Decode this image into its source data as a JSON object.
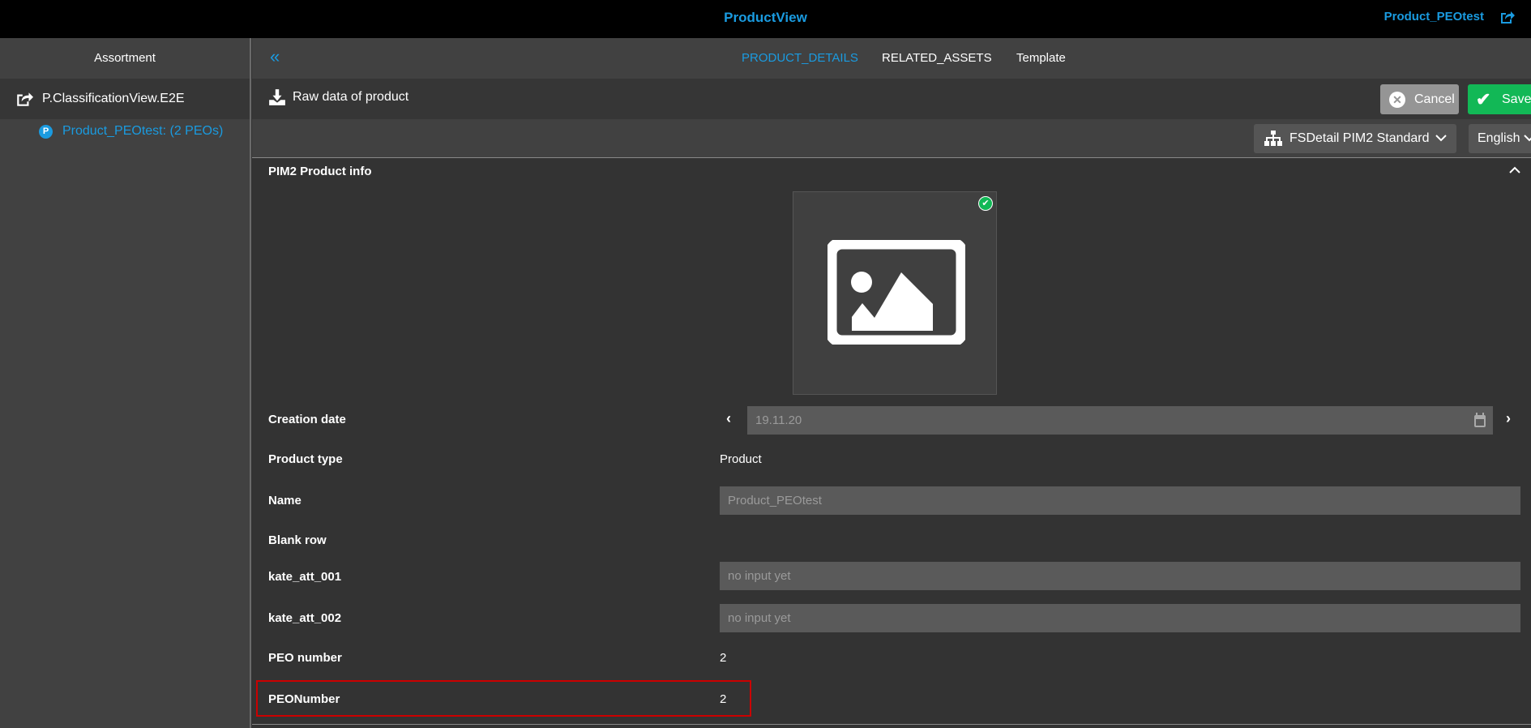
{
  "header": {
    "title": "ProductView",
    "user_link": "Product_PEOtest"
  },
  "sidebar": {
    "title": "Assortment",
    "root": "P.ClassificationView.E2E",
    "child_badge": "P",
    "child": "Product_PEOtest: (2 PEOs)"
  },
  "tabs": [
    {
      "label": "PRODUCT_DETAILS",
      "active": true
    },
    {
      "label": "RELATED_ASSETS"
    },
    {
      "label": "Template"
    }
  ],
  "toolbar": {
    "raw_data": "Raw data of product",
    "cancel": "Cancel",
    "save": "Save"
  },
  "view_select": "FSDetail PIM2 Standard",
  "language_select": "English",
  "section": {
    "title": "PIM2 Product info"
  },
  "fields": {
    "creation_date": {
      "label": "Creation date",
      "value": "19.11.20"
    },
    "product_type": {
      "label": "Product type",
      "value": "Product"
    },
    "name": {
      "label": "Name",
      "value": "Product_PEOtest"
    },
    "blank_row": {
      "label": "Blank row"
    },
    "kate_att_001": {
      "label": "kate_att_001",
      "placeholder": "no input yet"
    },
    "kate_att_002": {
      "label": "kate_att_002",
      "placeholder": "no input yet"
    },
    "peo_number": {
      "label": "PEO number",
      "value": "2"
    },
    "peonumber": {
      "label": "PEONumber",
      "value": "2"
    }
  },
  "colors": {
    "accent": "#1a9be0",
    "save": "#12b856",
    "cancel": "#959595",
    "highlight": "#cc0000"
  }
}
